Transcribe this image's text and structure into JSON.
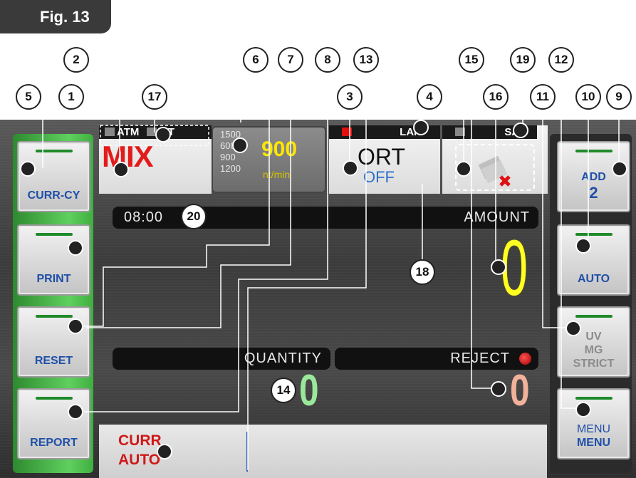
{
  "figure_label": "Fig. 13",
  "status": {
    "atm": "ATM",
    "fit": "FIT",
    "mix": "MIX",
    "lan": "LAN",
    "san": "SAN",
    "ort": "ORT",
    "off": "OFF"
  },
  "speed": {
    "options": [
      "1500",
      "600",
      "900",
      "1200"
    ],
    "value": "900",
    "unit": "nt/min"
  },
  "display": {
    "time": "08:00",
    "amount_label": "AMOUNT",
    "amount_value": "0",
    "quantity_label": "QUANTITY",
    "quantity_value": "0",
    "reject_label": "REJECT",
    "reject_value": "0"
  },
  "left_buttons": [
    {
      "label": "CURR-CY"
    },
    {
      "label": "PRINT"
    },
    {
      "label": "RESET"
    },
    {
      "label": "REPORT"
    }
  ],
  "right_buttons": [
    {
      "line1": "ADD",
      "line2": "2"
    },
    {
      "line1": "AUTO"
    },
    {
      "line1": "UV",
      "line2": "MG",
      "line3": "STRICT"
    },
    {
      "line1": "MENU",
      "line2": "MENU"
    }
  ],
  "bottom": {
    "curr_line1": "CURR",
    "curr_line2": "AUTO"
  },
  "callouts": [
    "1",
    "2",
    "3",
    "4",
    "5",
    "6",
    "7",
    "8",
    "9",
    "10",
    "11",
    "12",
    "13",
    "14",
    "15",
    "16",
    "17",
    "18",
    "19",
    "20"
  ],
  "colors": {
    "mix_red": "#e21b1b",
    "speed_yellow": "#ffe600",
    "amount_yellow": "#ffff22",
    "quantity_green": "#9ae89a",
    "reject_peach": "#f2b29a",
    "button_blue": "#1f4fa8",
    "curr_red": "#d01818",
    "side_green": "#4fc04f"
  }
}
